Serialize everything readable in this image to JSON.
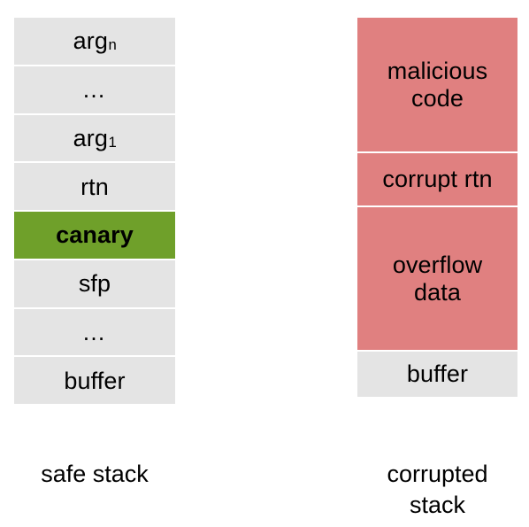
{
  "colors": {
    "background": "#ffffff",
    "cell_gray": "#e4e4e4",
    "canary_green": "#6fa02a",
    "attack_red": "#e08080",
    "text": "#000000",
    "separator": "#ffffff"
  },
  "safe_stack": {
    "caption": "safe stack",
    "cells": [
      {
        "label": "arg",
        "subscript": "n",
        "style": "gray"
      },
      {
        "label": "…",
        "subscript": "",
        "style": "gray"
      },
      {
        "label": "arg",
        "subscript": "1",
        "style": "gray"
      },
      {
        "label": "rtn",
        "subscript": "",
        "style": "gray"
      },
      {
        "label": "canary",
        "subscript": "",
        "style": "green"
      },
      {
        "label": "sfp",
        "subscript": "",
        "style": "gray"
      },
      {
        "label": "…",
        "subscript": "",
        "style": "gray"
      },
      {
        "label": "buffer",
        "subscript": "",
        "style": "gray"
      }
    ]
  },
  "corrupted_stack": {
    "caption": "corrupted\nstack",
    "cells": [
      {
        "label": "malicious\ncode",
        "style": "red"
      },
      {
        "label": "corrupt rtn",
        "style": "red"
      },
      {
        "label": "overflow\ndata",
        "style": "red"
      },
      {
        "label": "buffer",
        "style": "gray"
      }
    ]
  }
}
